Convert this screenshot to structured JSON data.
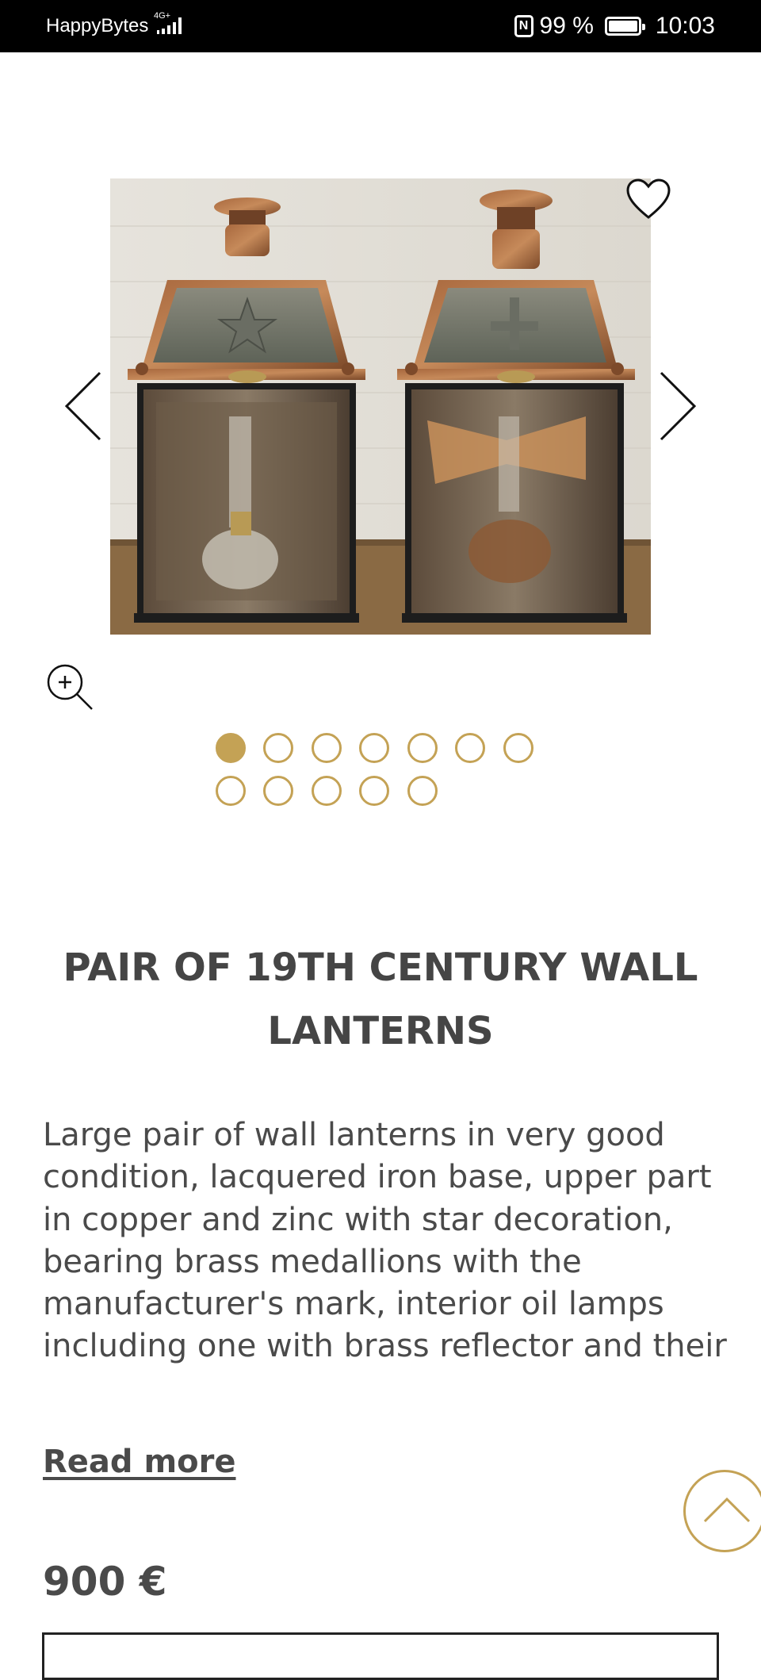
{
  "status_bar": {
    "carrier": "HappyBytes",
    "network": "4G+",
    "nfc": "N",
    "battery": "99 %",
    "time": "10:03"
  },
  "gallery": {
    "image_alt": "Pair of copper and iron wall lanterns with glass panels",
    "current_slide": 1,
    "total_slides": 12,
    "icons": {
      "prev": "chevron-left-icon",
      "next": "chevron-right-icon",
      "wishlist": "heart-icon",
      "zoom": "zoom-in-icon"
    }
  },
  "product": {
    "title": "PAIR OF 19TH CENTURY WALL LANTERNS",
    "description": "Large pair of wall lanterns in very good condition, lacquered iron base, upper part in copper and zinc with star decoration, bearing brass medallions with the manufacturer's mark, interior oil lamps including one with brass reflector and their glasses, all the tiles in good condition,",
    "read_more": "Read more",
    "price": "900 €"
  },
  "colors": {
    "accent": "#c4a255",
    "text": "#4a4a4a",
    "status_bar": "#000000"
  }
}
